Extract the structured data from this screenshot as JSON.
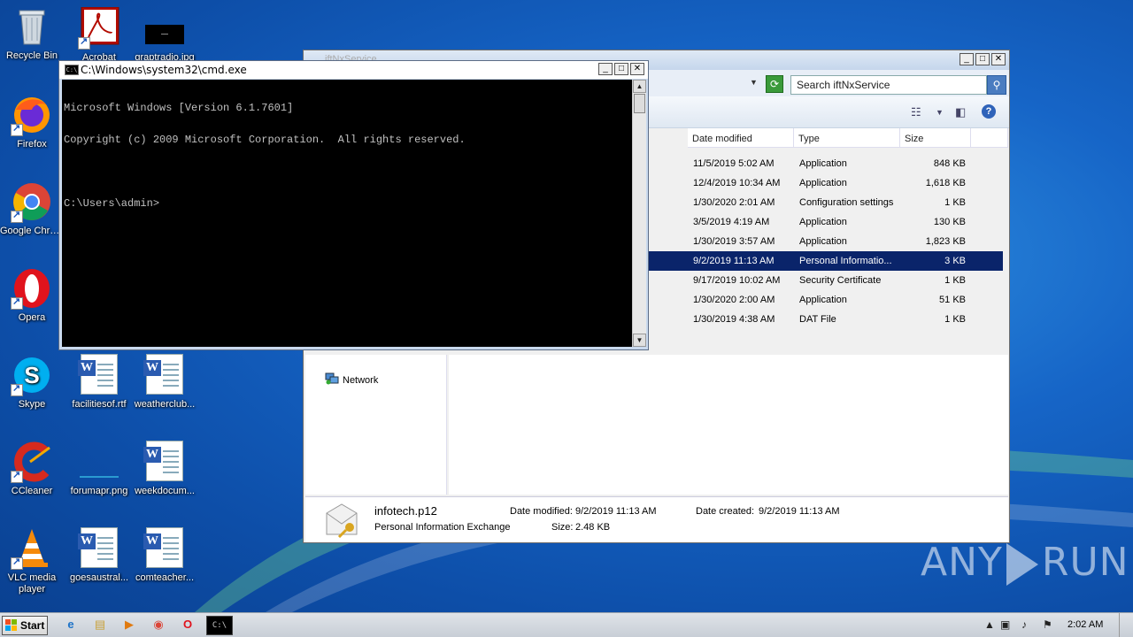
{
  "desktop": {
    "icons": [
      {
        "label": "Recycle Bin"
      },
      {
        "label": "Acrobat"
      },
      {
        "label": "graptradio.jpg"
      },
      {
        "label": "Firefox"
      },
      {
        "label": "Google Chrome"
      },
      {
        "label": "Opera"
      },
      {
        "label": "Skype"
      },
      {
        "label": "facilitiesof.rtf"
      },
      {
        "label": "weatherclub..."
      },
      {
        "label": "CCleaner"
      },
      {
        "label": "forumapr.png"
      },
      {
        "label": "weekdocum..."
      },
      {
        "label": "VLC media player"
      },
      {
        "label": "goesaustral..."
      },
      {
        "label": "comteacher..."
      }
    ]
  },
  "explorer": {
    "title": "iftNxService",
    "search_placeholder": "Search iftNxService",
    "columns": [
      "Date modified",
      "Type",
      "Size"
    ],
    "rows": [
      {
        "date": "11/5/2019 5:02 AM",
        "type": "Application",
        "size": "848 KB"
      },
      {
        "date": "12/4/2019 10:34 AM",
        "type": "Application",
        "size": "1,618 KB"
      },
      {
        "date": "1/30/2020 2:01 AM",
        "type": "Configuration settings",
        "size": "1 KB"
      },
      {
        "date": "3/5/2019 4:19 AM",
        "type": "Application",
        "size": "130 KB"
      },
      {
        "date": "1/30/2019 3:57 AM",
        "type": "Application",
        "size": "1,823 KB"
      },
      {
        "date": "9/2/2019 11:13 AM",
        "type": "Personal Informatio...",
        "size": "3 KB"
      },
      {
        "date": "9/17/2019 10:02 AM",
        "type": "Security Certificate",
        "size": "1 KB"
      },
      {
        "date": "1/30/2020 2:00 AM",
        "type": "Application",
        "size": "51 KB"
      },
      {
        "date": "1/30/2019 4:38 AM",
        "type": "DAT File",
        "size": "1 KB"
      }
    ],
    "selected_row_index": 5,
    "nav_network": "Network",
    "details": {
      "filename": "infotech.p12",
      "filetype": "Personal Information Exchange",
      "date_modified_label": "Date modified:",
      "date_modified": "9/2/2019 11:13 AM",
      "date_created_label": "Date created:",
      "date_created": "9/2/2019 11:13 AM",
      "size_label": "Size:",
      "size": "2.48 KB"
    }
  },
  "cmd": {
    "title": "C:\\Windows\\system32\\cmd.exe",
    "lines": [
      "Microsoft Windows [Version 6.1.7601]",
      "Copyright (c) 2009 Microsoft Corporation.  All rights reserved.",
      "",
      "C:\\Users\\admin>"
    ]
  },
  "taskbar": {
    "start_label": "Start",
    "clock": "2:02 AM"
  },
  "watermark": {
    "left": "ANY",
    "right": "RUN"
  }
}
